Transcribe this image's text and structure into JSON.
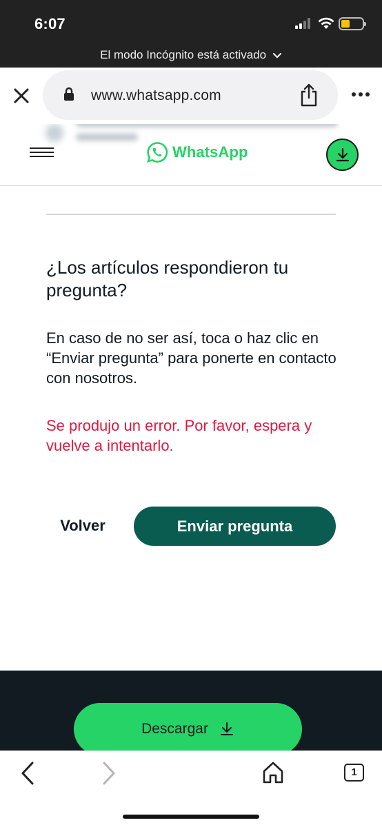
{
  "status_bar": {
    "time": "6:07",
    "battery_level": 0.33,
    "battery_color": "#f7c20b"
  },
  "browser": {
    "incognito_banner": "El modo Incógnito está activado",
    "url": "www.whatsapp.com",
    "tab_count": "1",
    "icons": [
      "close-icon",
      "lock-icon",
      "share-icon",
      "more-icon",
      "back-arrow-icon",
      "forward-arrow-icon",
      "home-icon",
      "tabs-icon"
    ]
  },
  "site_header": {
    "brand": "WhatsApp",
    "brand_color": "#25d366"
  },
  "feedback": {
    "question": "¿Los artículos respondieron tu pregunta?",
    "description": "En caso de no ser así, toca o haz clic en “Enviar pregunta” para ponerte en contacto con nosotros.",
    "error": "Se produjo un error. Por favor, espera y vuelve a intentarlo.",
    "error_color": "#e0193f",
    "back_label": "Volver",
    "send_label": "Enviar pregunta",
    "send_color": "#0b5c50"
  },
  "footer": {
    "download_label": "Descargar"
  }
}
